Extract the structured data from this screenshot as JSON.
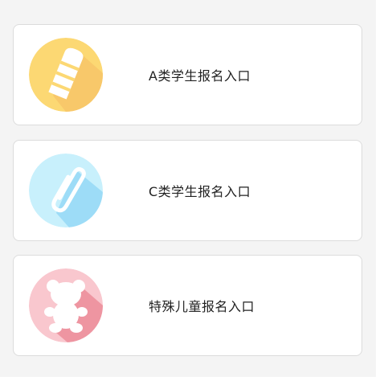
{
  "entries": [
    {
      "label": "A类学生报名入口",
      "icon": "pencil-icon",
      "color": "#fcd873",
      "shadow": "#f8bd64"
    },
    {
      "label": "C类学生报名入口",
      "icon": "paperclip-icon",
      "color": "#c8f0fc",
      "shadow": "#8ad4f5"
    },
    {
      "label": "特殊儿童报名入口",
      "icon": "teddy-bear-icon",
      "color": "#f9c7ce",
      "shadow": "#ec8a97"
    }
  ],
  "colors": {
    "page_background": "#f4f4f4",
    "card_background": "#ffffff",
    "card_border": "#dcdcdc",
    "text": "#222222"
  }
}
